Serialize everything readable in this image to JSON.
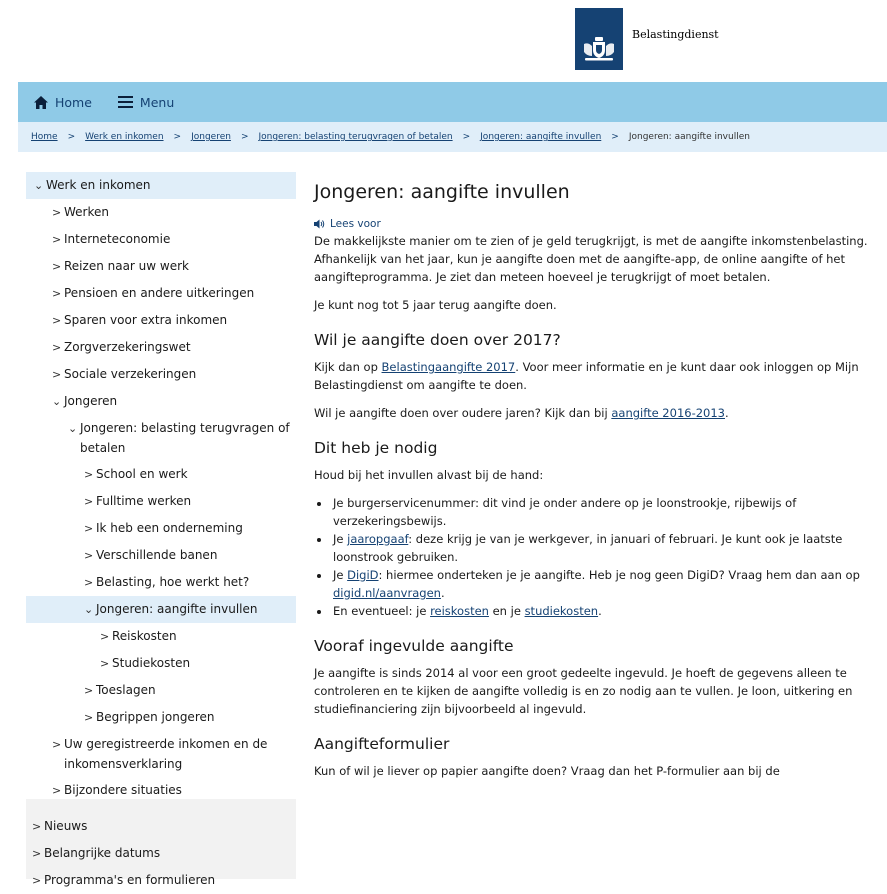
{
  "header": {
    "logo_text": "Belastingdienst"
  },
  "nav": {
    "home": "Home",
    "menu": "Menu"
  },
  "breadcrumb": {
    "items": [
      "Home",
      "Werk en inkomen",
      "Jongeren",
      "Jongeren: belasting terugvragen of betalen",
      "Jongeren: aangifte invullen"
    ],
    "current": "Jongeren: aangifte invullen",
    "separator": ">"
  },
  "sidebar": {
    "items": [
      {
        "label": "Werk en inkomen",
        "chevron": "⌄"
      },
      {
        "label": "Werken",
        "chevron": ">"
      },
      {
        "label": "Interneteconomie",
        "chevron": ">"
      },
      {
        "label": "Reizen naar uw werk",
        "chevron": ">"
      },
      {
        "label": "Pensioen en andere uitkeringen",
        "chevron": ">"
      },
      {
        "label": "Sparen voor extra inkomen",
        "chevron": ">"
      },
      {
        "label": "Zorgverzekeringswet",
        "chevron": ">"
      },
      {
        "label": "Sociale verzekeringen",
        "chevron": ">"
      },
      {
        "label": "Jongeren",
        "chevron": "⌄"
      },
      {
        "label": "Jongeren: belasting terugvragen of betalen",
        "chevron": "⌄"
      },
      {
        "label": "School en werk",
        "chevron": ">"
      },
      {
        "label": "Fulltime werken",
        "chevron": ">"
      },
      {
        "label": "Ik heb een onderneming",
        "chevron": ">"
      },
      {
        "label": "Verschillende banen",
        "chevron": ">"
      },
      {
        "label": "Belasting, hoe werkt het?",
        "chevron": ">"
      },
      {
        "label": "Jongeren: aangifte invullen",
        "chevron": "⌄"
      },
      {
        "label": "Reiskosten",
        "chevron": ">"
      },
      {
        "label": "Studiekosten",
        "chevron": ">"
      },
      {
        "label": "Toeslagen",
        "chevron": ">"
      },
      {
        "label": "Begrippen jongeren",
        "chevron": ">"
      },
      {
        "label": "Uw geregistreerde inkomen en de inkomensverklaring",
        "chevron": ">"
      },
      {
        "label": "Bijzondere situaties",
        "chevron": ">"
      }
    ],
    "bottom_items": [
      {
        "label": "Nieuws",
        "chevron": ">"
      },
      {
        "label": "Belangrijke datums",
        "chevron": ">"
      },
      {
        "label": "Programma's en formulieren",
        "chevron": ">"
      }
    ]
  },
  "main": {
    "title": "Jongeren: aangifte invullen",
    "listen_label": "Lees voor",
    "intro": "De makkelijkste manier om te zien of je geld terugkrijgt, is met de aangifte inkomstenbelasting. Afhankelijk van het jaar, kun je aangifte doen met de aangifte-app, de online aangifte of het aangifteprogramma. Je ziet dan meteen hoeveel je terugkrijgt of moet betalen.",
    "five_years": "Je kunt nog tot 5 jaar terug aangifte doen.",
    "s1_heading": "Wil je aangifte doen over 2017?",
    "s1_p1_a": "Kijk dan op ",
    "s1_p1_link": "Belastingaangifte 2017",
    "s1_p1_b": ". Voor meer informatie en je kunt daar ook inloggen op Mijn Belastingdienst om aangifte te doen.",
    "s1_p2_a": "Wil je aangifte doen over oudere jaren? Kijk dan bij ",
    "s1_p2_link": "aangifte 2016-2013",
    "s1_p2_b": ".",
    "s2_heading": "Dit heb je nodig",
    "s2_intro": "Houd bij het invullen alvast bij de hand:",
    "b1": "Je burgerservicenummer: dit vind je onder andere op je loonstrookje, rijbewijs of verzekeringsbewijs.",
    "b2_a": "Je ",
    "b2_link": "jaaropgaaf",
    "b2_b": ": deze krijg je van je werkgever, in januari of februari. Je kunt ook je laatste loonstrook gebruiken.",
    "b3_a": "Je ",
    "b3_link": "DigiD",
    "b3_b": ": hiermee onderteken je je aangifte. Heb je nog geen DigiD? Vraag hem dan aan op ",
    "b3_link2": "digid.nl/aanvragen",
    "b3_c": ".",
    "b4_a": "En eventueel: je ",
    "b4_link": "reiskosten",
    "b4_b": " en je ",
    "b4_link2": "studiekosten",
    "b4_c": ".",
    "s3_heading": "Vooraf ingevulde aangifte",
    "s3_p": "Je aangifte is sinds 2014 al voor een groot gedeelte ingevuld. Je hoeft de gegevens alleen te controleren en te kijken de aangifte volledig is en zo nodig aan te vullen. Je loon, uitkering en studiefinanciering zijn bijvoorbeeld al ingevuld.",
    "s4_heading": "Aangifteformulier",
    "s4_p": "Kun of wil je liever op papier aangifte doen? Vraag dan het P-formulier aan bij de"
  }
}
